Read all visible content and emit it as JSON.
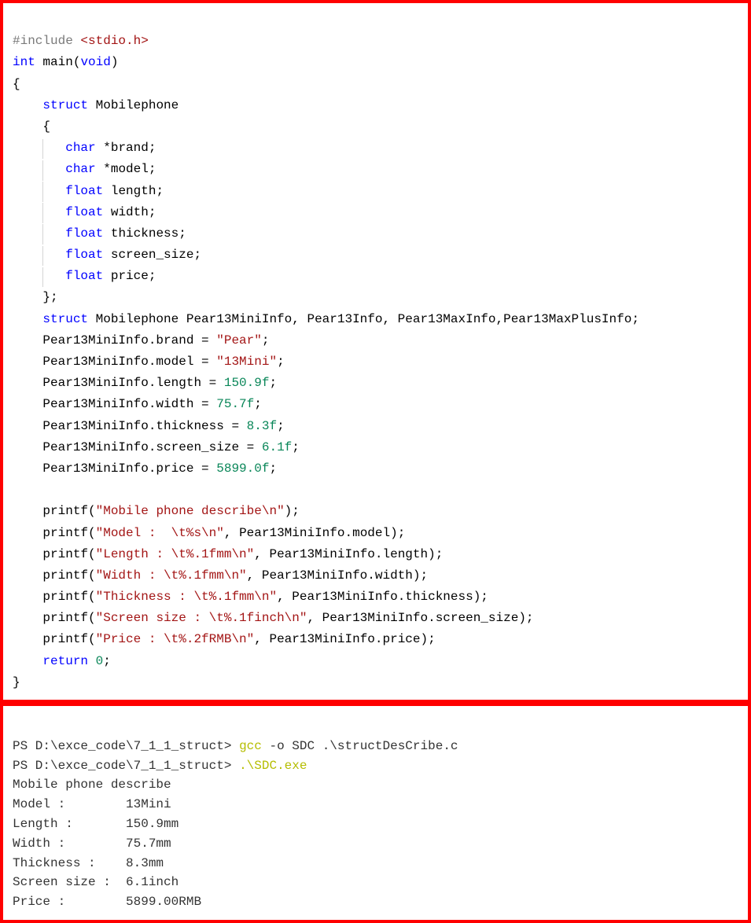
{
  "code": {
    "include_directive": "#include",
    "include_header": "<stdio.h>",
    "kw_int": "int",
    "fn_main": "main",
    "kw_void": "void",
    "brace_open": "{",
    "brace_close": "}",
    "kw_struct": "struct",
    "struct_name": "Mobilephone",
    "kw_char": "char",
    "kw_float": "float",
    "fld_brand": "*brand;",
    "fld_model": "*model;",
    "fld_length": "length;",
    "fld_width": "width;",
    "fld_thickness": "thickness;",
    "fld_screen_size": "screen_size;",
    "fld_price": "price;",
    "struct_close": "};",
    "decl_line": " Mobilephone Pear13MiniInfo, Pear13Info, Pear13MaxInfo,Pear13MaxPlusInfo;",
    "assign_brand_l": "Pear13MiniInfo.brand = ",
    "assign_brand_v": "\"Pear\"",
    "assign_model_l": "Pear13MiniInfo.model = ",
    "assign_model_v": "\"13Mini\"",
    "assign_length_l": "Pear13MiniInfo.length = ",
    "assign_length_v": "150.9f",
    "assign_width_l": "Pear13MiniInfo.width = ",
    "assign_width_v": "75.7f",
    "assign_thickness_l": "Pear13MiniInfo.thickness = ",
    "assign_thickness_v": "8.3f",
    "assign_screen_l": "Pear13MiniInfo.screen_size = ",
    "assign_screen_v": "6.1f",
    "assign_price_l": "Pear13MiniInfo.price = ",
    "assign_price_v": "5899.0f",
    "semi": ";",
    "printf": "printf(",
    "p1_str": "\"Mobile phone describe\\n\"",
    "p1_end": ");",
    "p2_str": "\"Model :  \\t%s\\n\"",
    "p2_arg": ", Pear13MiniInfo.model);",
    "p3_str": "\"Length : \\t%.1fmm\\n\"",
    "p3_arg": ", Pear13MiniInfo.length);",
    "p4_str": "\"Width : \\t%.1fmm\\n\"",
    "p4_arg": ", Pear13MiniInfo.width);",
    "p5_str": "\"Thickness : \\t%.1fmm\\n\"",
    "p5_arg": ", Pear13MiniInfo.thickness);",
    "p6_str": "\"Screen size : \\t%.1finch\\n\"",
    "p6_arg": ", Pear13MiniInfo.screen_size);",
    "p7_str": "\"Price : \\t%.2fRMB\\n\"",
    "p7_arg": ", Pear13MiniInfo.price);",
    "kw_return": "return",
    "ret_val": "0"
  },
  "terminal": {
    "prompt": "PS D:\\exce_code\\7_1_1_struct>",
    "cmd1a": "gcc",
    "cmd1b": " -o SDC .\\structDesCribe.c",
    "cmd2": ".\\SDC.exe",
    "out1": "Mobile phone describe",
    "out2": "Model :        13Mini",
    "out3": "Length :       150.9mm",
    "out4": "Width :        75.7mm",
    "out5": "Thickness :    8.3mm",
    "out6": "Screen size :  6.1inch",
    "out7": "Price :        5899.00RMB"
  }
}
